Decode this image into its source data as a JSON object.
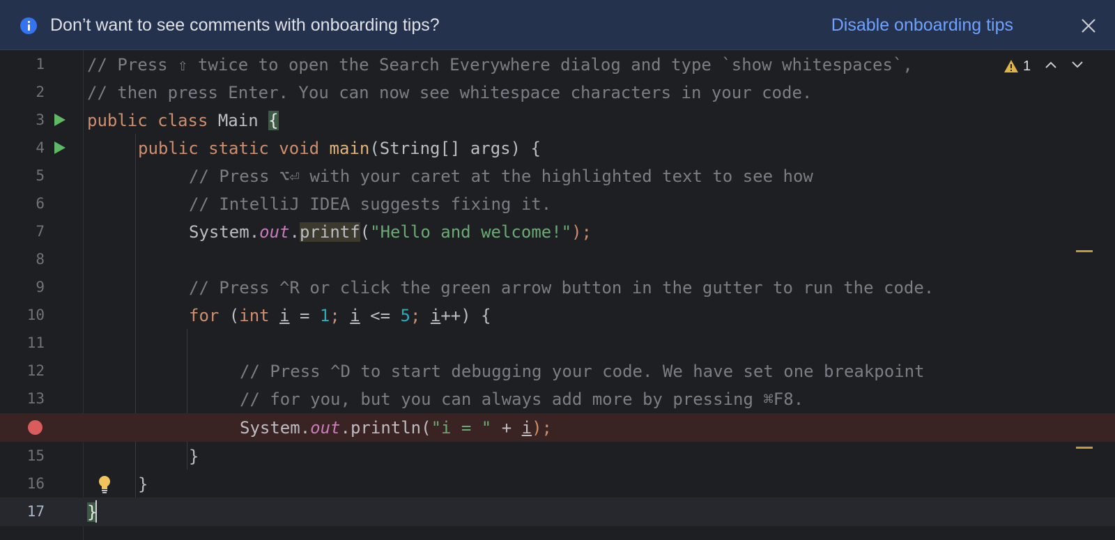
{
  "banner": {
    "message": "Don’t want to see comments with onboarding tips?",
    "action_label": "Disable onboarding tips",
    "info_icon": "info-icon",
    "close_icon": "close-icon"
  },
  "inspections": {
    "warning_count": "1",
    "warning_icon": "warning-icon"
  },
  "colors": {
    "banner_bg": "#25324d",
    "editor_bg": "#1e1f22",
    "link": "#6ea2ff",
    "keyword": "#cf8e6d",
    "comment": "#7a7e85",
    "string": "#6aab73",
    "number": "#2aacb8",
    "run_icon": "#5fb865",
    "breakpoint": "#db5c5c"
  },
  "editor": {
    "line_numbers": [
      "1",
      "2",
      "3",
      "4",
      "5",
      "6",
      "7",
      "8",
      "9",
      "10",
      "11",
      "12",
      "13",
      "15",
      "16",
      "17"
    ],
    "code": {
      "l1": "// Press ⇧ twice to open the Search Everywhere dialog and type `show whitespaces`,",
      "l2": "// then press Enter. You can now see whitespace characters in your code.",
      "l3_kw": "public class",
      "l3_name": " Main ",
      "l3_brace": "{",
      "l4_kw": "public static void",
      "l4_fn": "main",
      "l4_rest": "(String[] args) {",
      "l5": "// Press ⌥⏎ with your caret at the highlighted text to see how",
      "l6": "// IntelliJ IDEA suggests fixing it.",
      "l7_a": "System.",
      "l7_out": "out",
      "l7_dot": ".",
      "l7_fn": "printf",
      "l7_paren": "(",
      "l7_str": "\"Hello and welcome!\"",
      "l7_end": ");",
      "l9": "// Press ^R or click the green arrow button in the gutter to run the code.",
      "l10_for": "for",
      "l10_p1": " (",
      "l10_int": "int",
      "l10_i1": "i",
      "l10_eq": " = ",
      "l10_n1": "1",
      "l10_semi1": "; ",
      "l10_i2": "i",
      "l10_le": " <= ",
      "l10_n5": "5",
      "l10_semi2": "; ",
      "l10_i3": "i",
      "l10_end": "++) {",
      "l12": "// Press ^D to start debugging your code. We have set one breakpoint",
      "l13": "// for you, but you can always add more by pressing ⌘F8.",
      "l14_a": "System.",
      "l14_out": "out",
      "l14_b": ".println(",
      "l14_str": "\"i = \"",
      "l14_plus": " + ",
      "l14_i": "i",
      "l14_end": ");",
      "l15": "}",
      "l16": "}",
      "l17": "}"
    }
  }
}
